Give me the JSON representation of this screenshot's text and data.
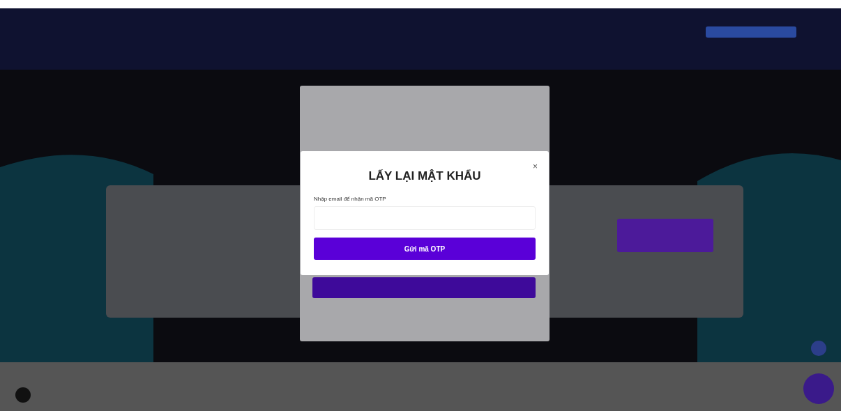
{
  "dialog": {
    "title": "LẤY LẠI MẬT KHẨU",
    "close": "×",
    "email_label": "Nhập email để nhận mã OTP",
    "submit_button": "Gửi mã OTP"
  }
}
